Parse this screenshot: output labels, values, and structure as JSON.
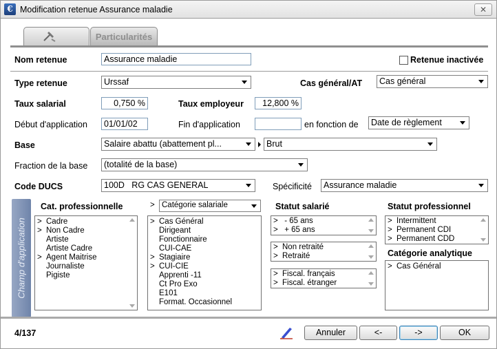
{
  "window": {
    "title": "Modification retenue Assurance maladie",
    "close_glyph": "✕",
    "app_icon": "€"
  },
  "tabs": [
    {
      "label": "",
      "icon": "hammer-icon"
    },
    {
      "label": "Particularités"
    }
  ],
  "form": {
    "nom_label": "Nom retenue",
    "nom_value": "Assurance maladie",
    "inactive_label": "Retenue inactivée",
    "type_label": "Type retenue",
    "type_value": "Urssaf",
    "cas_label": "Cas général/AT",
    "cas_value": "Cas général",
    "taux_sal_label": "Taux salarial",
    "taux_sal_value": "0,750 %",
    "taux_emp_label": "Taux employeur",
    "taux_emp_value": "12,800 %",
    "debut_label": "Début d'application",
    "debut_value": "01/01/02",
    "fin_label": "Fin d'application",
    "fin_value": "",
    "fonction_label": "en fonction de",
    "fonction_value": "Date de règlement",
    "base_label": "Base",
    "base_value": "Salaire abattu (abattement pl...",
    "base2_value": "Brut",
    "fraction_label": "Fraction de la base",
    "fraction_value": "(totalité de la base)",
    "ducs_label": "Code DUCS",
    "ducs_value": "100D   RG CAS GENERAL",
    "specificite_label": "Spécificité",
    "specificite_value": "Assurance maladie"
  },
  "champ": {
    "side_label": "Champ d'application",
    "cat_pro_title": "Cat. professionnelle",
    "cat_pro_items": [
      {
        "mark": ">",
        "label": "Cadre"
      },
      {
        "mark": ">",
        "label": "Non Cadre"
      },
      {
        "mark": "",
        "label": "Artiste"
      },
      {
        "mark": "",
        "label": "Artiste Cadre"
      },
      {
        "mark": ">",
        "label": "Agent Maitrise"
      },
      {
        "mark": "",
        "label": "Journaliste"
      },
      {
        "mark": "",
        "label": "Pigiste"
      }
    ],
    "cat_sal_prefix": ">",
    "cat_sal_select": "Catégorie salariale",
    "cat_sal_items": [
      {
        "mark": ">",
        "label": "Cas Général"
      },
      {
        "mark": "",
        "label": "Dirigeant"
      },
      {
        "mark": "",
        "label": "Fonctionnaire"
      },
      {
        "mark": "",
        "label": "CUI-CAE"
      },
      {
        "mark": ">",
        "label": "Stagiaire"
      },
      {
        "mark": ">",
        "label": "CUI-CIE"
      },
      {
        "mark": "",
        "label": "Apprenti -11"
      },
      {
        "mark": "",
        "label": "Ct Pro Exo"
      },
      {
        "mark": "",
        "label": "E101"
      },
      {
        "mark": "",
        "label": "Format. Occasionnel"
      }
    ],
    "statut_sal_title": "Statut salarié",
    "age_items": [
      {
        "mark": ">",
        "label": " - 65 ans"
      },
      {
        "mark": ">",
        "label": " + 65 ans"
      }
    ],
    "retraite_items": [
      {
        "mark": ">",
        "label": "Non retraité"
      },
      {
        "mark": ">",
        "label": "Retraité"
      }
    ],
    "fiscal_items": [
      {
        "mark": ">",
        "label": "Fiscal. français"
      },
      {
        "mark": ">",
        "label": "Fiscal. étranger"
      }
    ],
    "statut_pro_title": "Statut professionnel",
    "statut_pro_items": [
      {
        "mark": ">",
        "label": "Intermittent"
      },
      {
        "mark": ">",
        "label": "Permanent CDI"
      },
      {
        "mark": ">",
        "label": "Permanent CDD"
      }
    ],
    "cat_ana_title": "Catégorie analytique",
    "cat_ana_items": [
      {
        "mark": ">",
        "label": "Cas Général"
      }
    ]
  },
  "footer": {
    "record_counter": "4/137",
    "annuler_label": "Annuler",
    "prev_label": "<-",
    "next_label": "->",
    "ok_label": "OK"
  }
}
